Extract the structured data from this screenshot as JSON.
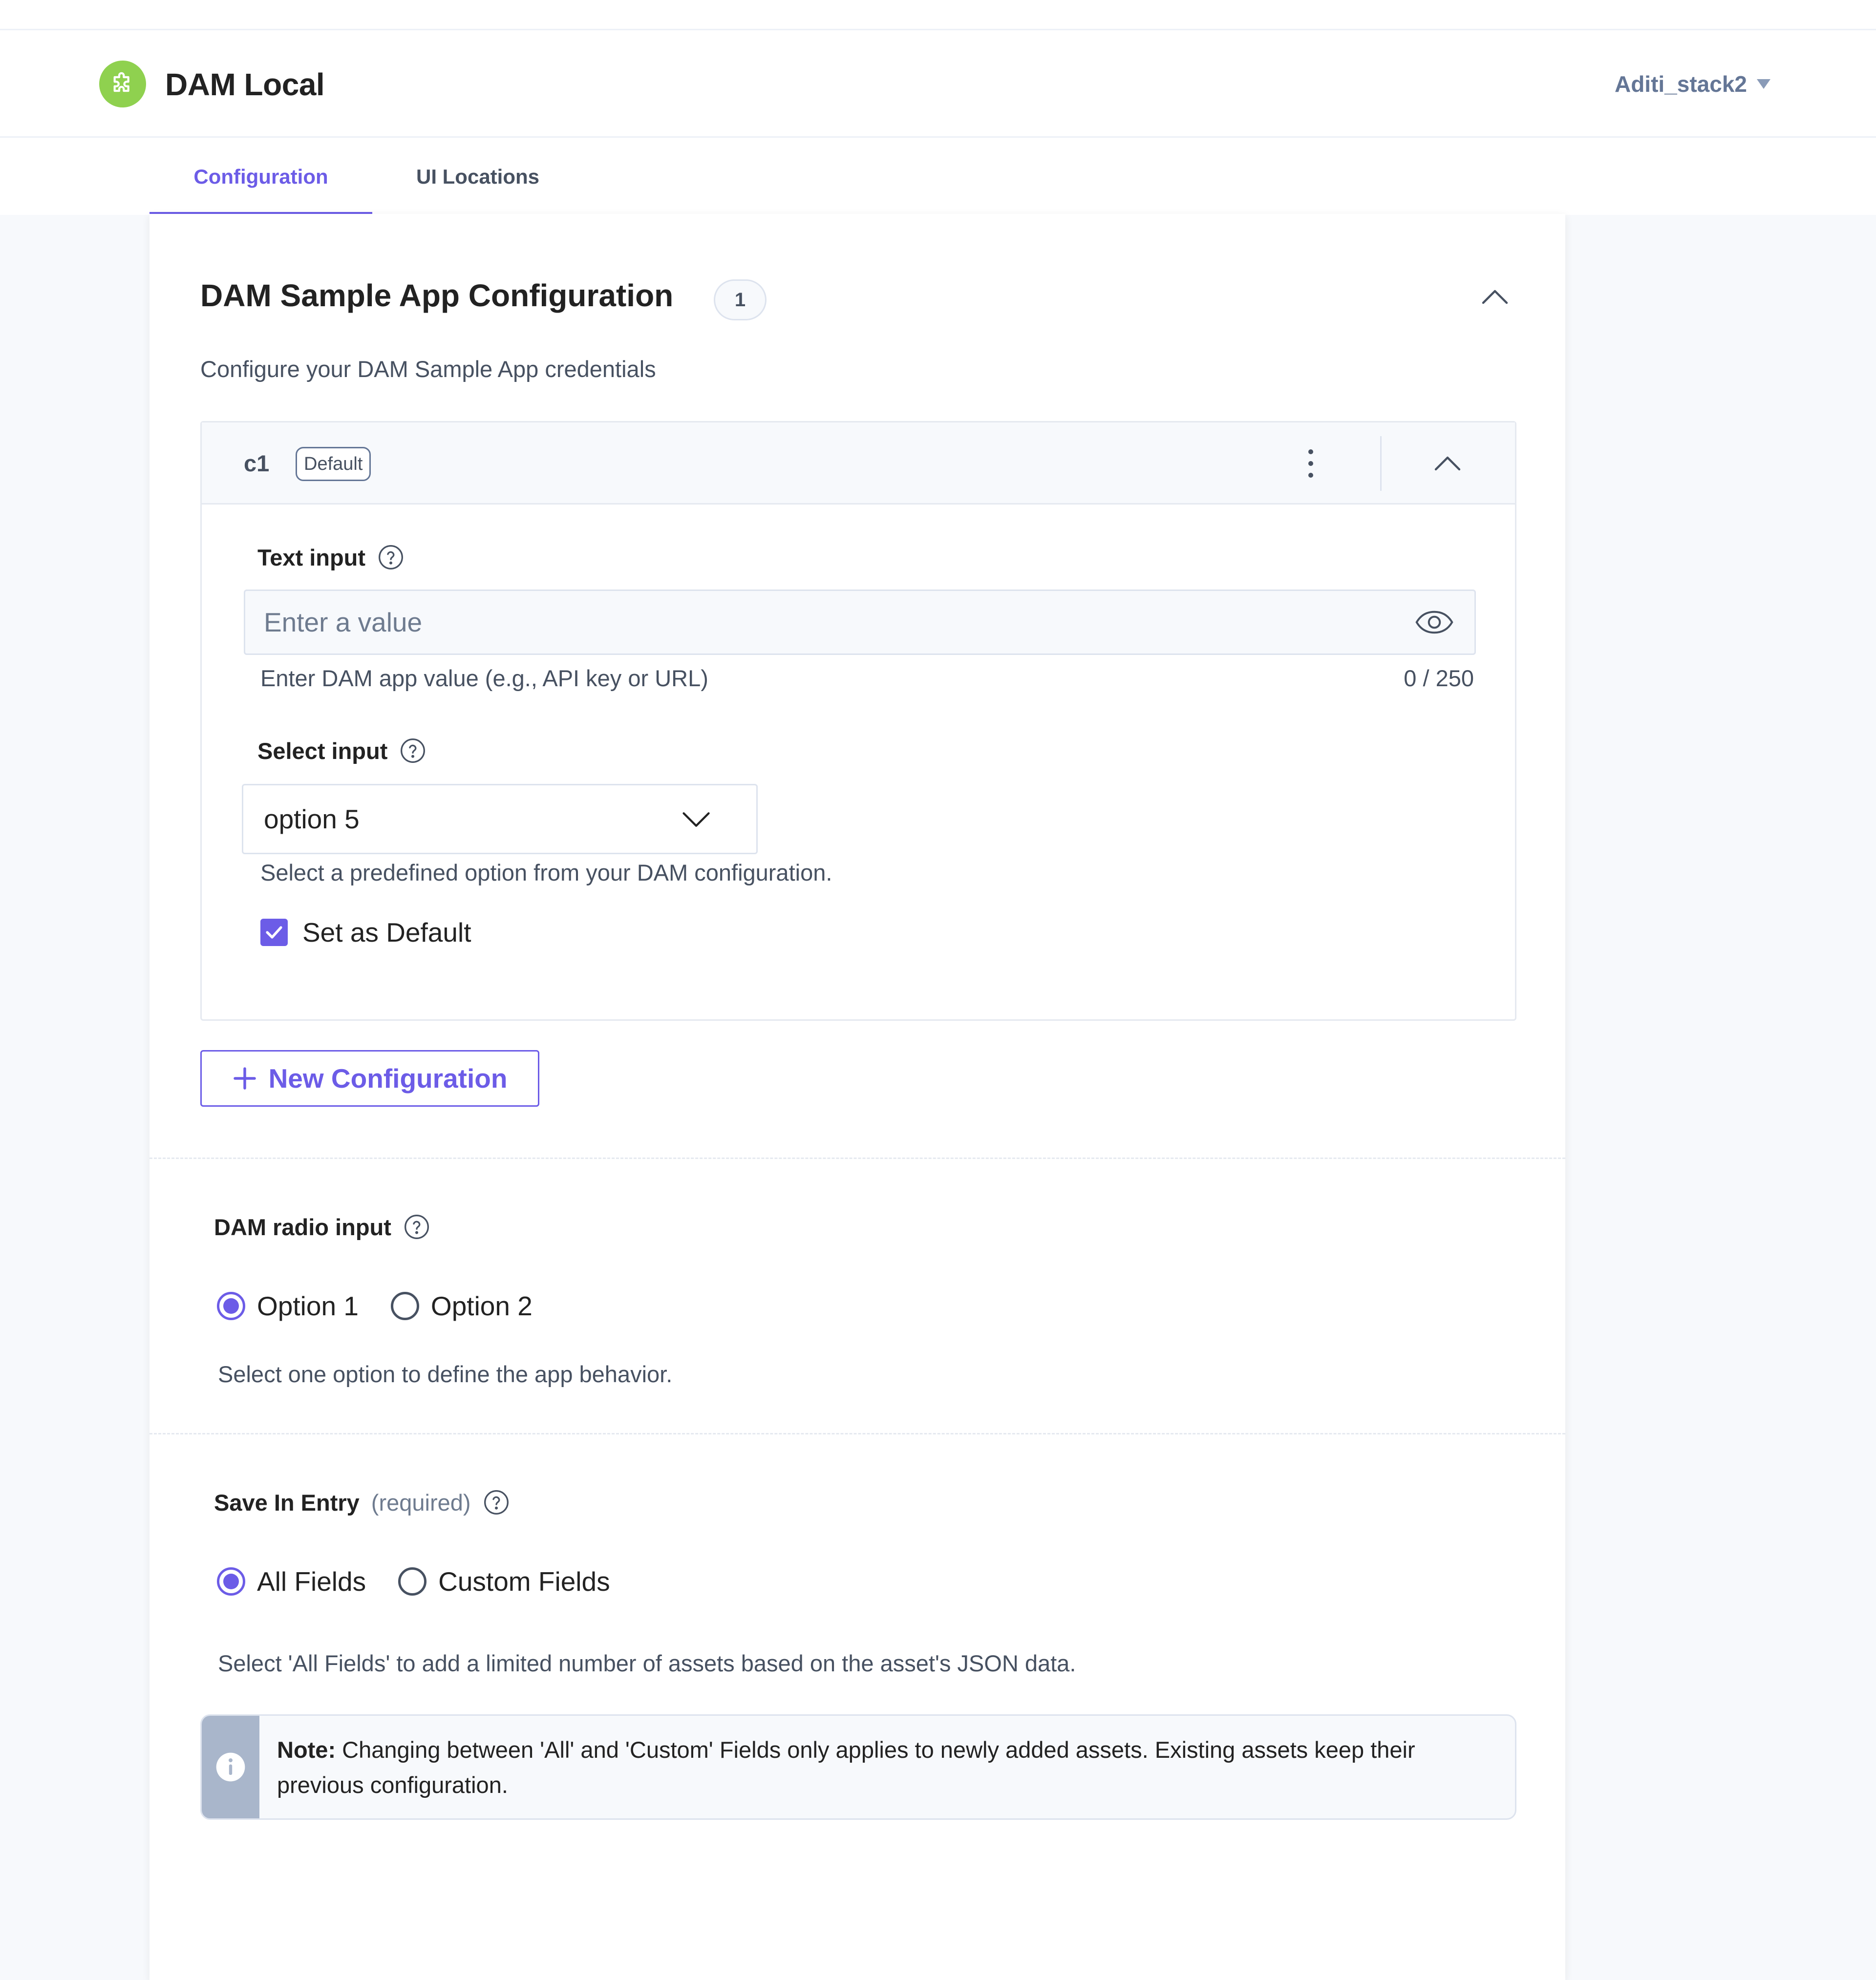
{
  "app": {
    "title": "DAM Local",
    "logo_icon": "puzzle-icon",
    "user": "Aditi_stack2",
    "colors": {
      "accent": "#6c5ce7",
      "logo": "#8fd14f",
      "text": "#222222",
      "muted": "#475161"
    }
  },
  "tabs": [
    {
      "label": "Configuration",
      "active": true
    },
    {
      "label": "UI Locations",
      "active": false
    }
  ],
  "section": {
    "title": "DAM Sample App Configuration",
    "count": "1",
    "description": "Configure your DAM Sample App credentials"
  },
  "config": {
    "name": "c1",
    "badge": "Default",
    "text_input": {
      "label": "Text input",
      "placeholder": "Enter a value",
      "value": "",
      "help": "Enter DAM app value (e.g., API key or URL)",
      "counter": "0 / 250"
    },
    "select_input": {
      "label": "Select input",
      "value": "option 5",
      "help": "Select a predefined option from your DAM configuration."
    },
    "set_default": {
      "label": "Set as Default",
      "checked": true
    }
  },
  "new_config_label": "New Configuration",
  "radio_input": {
    "label": "DAM radio input",
    "options": [
      {
        "label": "Option 1",
        "selected": true
      },
      {
        "label": "Option 2",
        "selected": false
      }
    ],
    "help": "Select one option to define the app behavior."
  },
  "save_in_entry": {
    "label": "Save In Entry",
    "required": "(required)",
    "options": [
      {
        "label": "All Fields",
        "selected": true
      },
      {
        "label": "Custom Fields",
        "selected": false
      }
    ],
    "help": "Select 'All Fields' to add a limited number of assets based on the asset's JSON data.",
    "note_label": "Note:",
    "note_text": "Changing between 'All' and 'Custom' Fields only applies to newly added assets. Existing assets keep their previous configuration."
  }
}
